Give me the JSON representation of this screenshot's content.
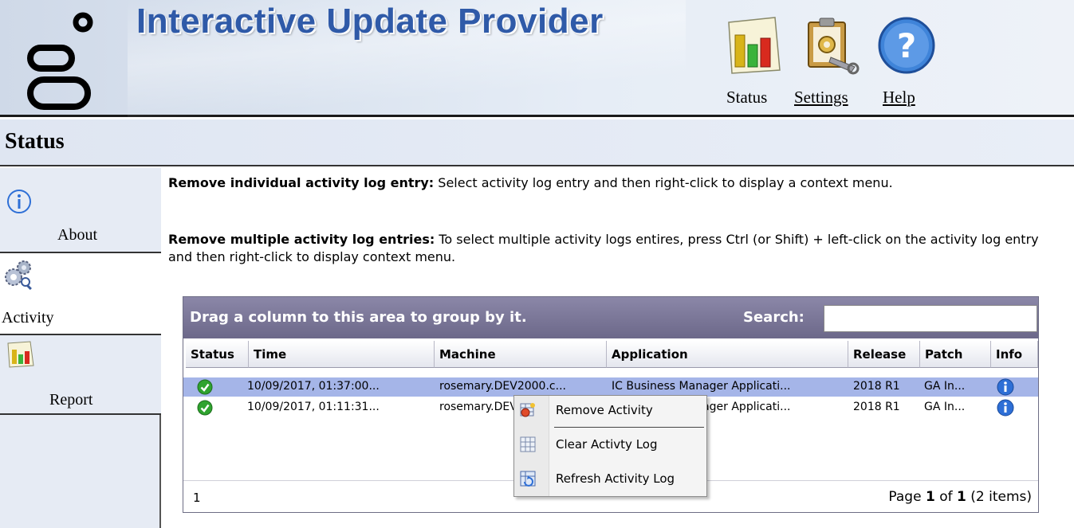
{
  "header": {
    "app_title": "Interactive Update Provider",
    "nav": {
      "status": "Status",
      "settings": "Settings",
      "help": "Help"
    }
  },
  "page": {
    "title": "Status"
  },
  "sidebar": {
    "items": [
      {
        "label": "About"
      },
      {
        "label": "Activity"
      },
      {
        "label": "Report"
      }
    ]
  },
  "instructions": {
    "individual_bold": "Remove individual activity log entry:",
    "individual_text": " Select activity log entry and then right-click to display a context menu.",
    "multiple_bold": "Remove multiple activity log entries:",
    "multiple_text": " To select multiple activity logs entires, press Ctrl (or Shift) + left-click on the activity log entry and then right-click to display context menu."
  },
  "grid": {
    "group_hint": "Drag a column to this area to group by it.",
    "search_label": "Search:",
    "search_value": "",
    "columns": {
      "status": "Status",
      "time": "Time",
      "machine": "Machine",
      "application": "Application",
      "release": "Release",
      "patch": "Patch",
      "info": "Info"
    },
    "rows": [
      {
        "time": "10/09/2017, 01:37:00...",
        "machine": "rosemary.DEV2000.c...",
        "application": "IC Business Manager Applicati...",
        "release": "2018 R1",
        "patch": "GA In...",
        "selected": true
      },
      {
        "time": "10/09/2017, 01:11:31...",
        "machine": "rosemary.DEV2000.c...",
        "application": "IC Business Manager Applicati...",
        "release": "2018 R1",
        "patch": "GA In...",
        "selected": false
      }
    ],
    "pager": {
      "current_page_link": "1",
      "prefix": "Page ",
      "page": "1",
      "of": " of ",
      "total_pages": "1",
      "items": " (2 items)"
    }
  },
  "context_menu": {
    "items": [
      {
        "label": "Remove Activity"
      },
      {
        "label": "Clear Activty Log"
      },
      {
        "label": "Refresh Activity Log"
      }
    ]
  }
}
